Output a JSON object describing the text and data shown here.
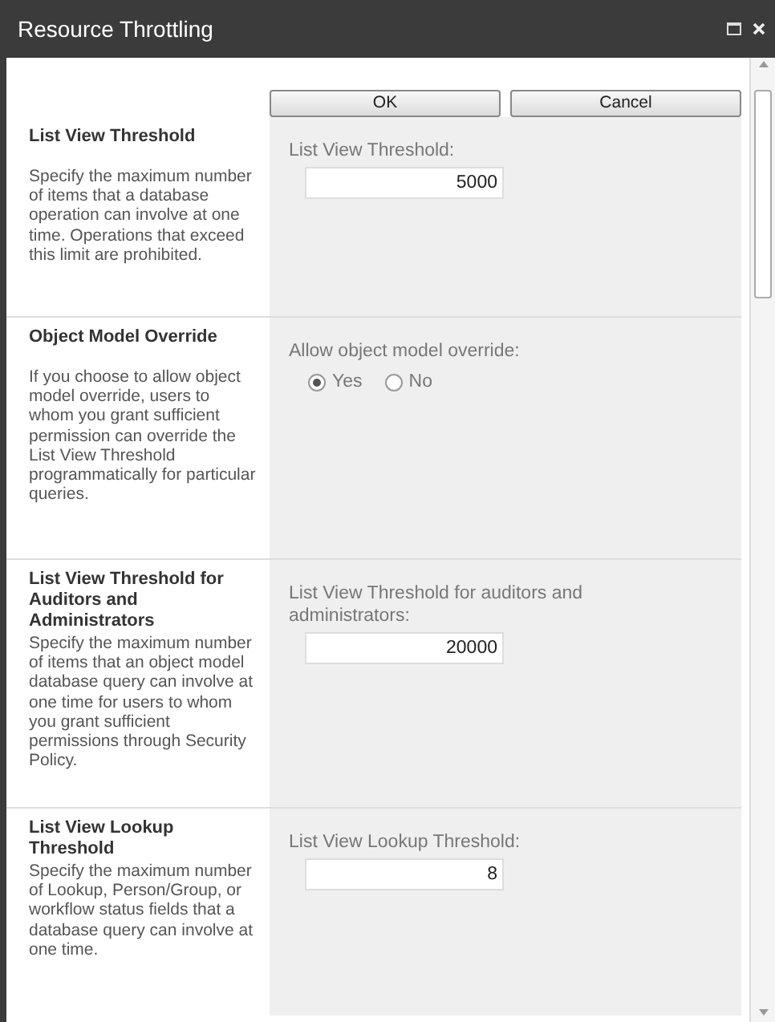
{
  "window": {
    "title": "Resource Throttling"
  },
  "buttons": [
    "OK",
    "Cancel"
  ],
  "sections": [
    {
      "title": "List View Threshold",
      "description": "Specify the maximum number of items that a database operation can involve at one time. Operations that exceed this limit are prohibited.",
      "field": {
        "kind": "textbox",
        "label": "List View Threshold:",
        "value": "5000"
      }
    },
    {
      "title": "Object Model Override",
      "description": "If you choose to allow object model override, users to whom you grant sufficient permission can override the List View Threshold programmatically for particular queries.",
      "field": {
        "kind": "radio",
        "label": "Allow object model override:",
        "options": [
          {
            "label": "Yes",
            "selected": true
          },
          {
            "label": "No",
            "selected": false
          }
        ]
      }
    },
    {
      "title": "List View Threshold for Auditors and Administrators",
      "description": "Specify the maximum number of items that an object model database query can involve at one time for users to whom you grant sufficient permissions through Security Policy.",
      "field": {
        "kind": "textbox",
        "label": "List View Threshold for auditors and administrators:",
        "value": "20000"
      }
    },
    {
      "title": "List View Lookup Threshold",
      "description": "Specify the maximum number of Lookup, Person/Group, or workflow status fields that a database query can involve at one time.",
      "field": {
        "kind": "textbox",
        "label": "List View Lookup Threshold:",
        "value": "8"
      }
    }
  ]
}
